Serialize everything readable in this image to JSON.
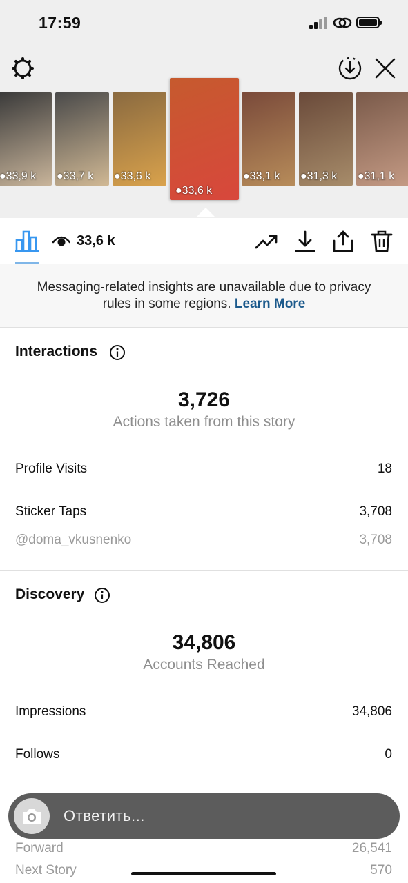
{
  "status_bar": {
    "time": "17:59"
  },
  "stories": [
    {
      "views": "33,9 k",
      "colors": [
        "#3a3a3a",
        "#c8b49a"
      ]
    },
    {
      "views": "33,7 k",
      "colors": [
        "#4a4a4a",
        "#d0b894"
      ]
    },
    {
      "views": "33,6 k",
      "colors": [
        "#8a6a40",
        "#d9a24c"
      ]
    },
    {
      "views": "33,6 k",
      "colors": [
        "#c65a2e",
        "#d8473c"
      ],
      "selected": true
    },
    {
      "views": "33,1 k",
      "colors": [
        "#7a4a3a",
        "#b78c5a"
      ]
    },
    {
      "views": "31,3 k",
      "colors": [
        "#6a4a3a",
        "#a78c6a"
      ]
    },
    {
      "views": "31,1 k",
      "colors": [
        "#7a5a4a",
        "#c49a84"
      ]
    }
  ],
  "toolbar": {
    "view_count": "33,6 k"
  },
  "notice": {
    "text": "Messaging-related insights are unavailable due to privacy rules in some regions.",
    "link": "Learn More"
  },
  "interactions": {
    "title": "Interactions",
    "total": "3,726",
    "total_label": "Actions taken from this story",
    "rows": [
      {
        "label": "Profile Visits",
        "value": "18"
      },
      {
        "label": "Sticker Taps",
        "value": "3,708"
      },
      {
        "label": "@doma_vkusnenko",
        "value": "3,708"
      }
    ]
  },
  "discovery": {
    "title": "Discovery",
    "total": "34,806",
    "total_label": "Accounts Reached",
    "rows": [
      {
        "label": "Impressions",
        "value": "34,806"
      },
      {
        "label": "Follows",
        "value": "0"
      },
      {
        "label": "Forward",
        "value": "26,541"
      },
      {
        "label": "Next Story",
        "value": "570"
      }
    ]
  },
  "reply": {
    "placeholder": "Ответить..."
  }
}
